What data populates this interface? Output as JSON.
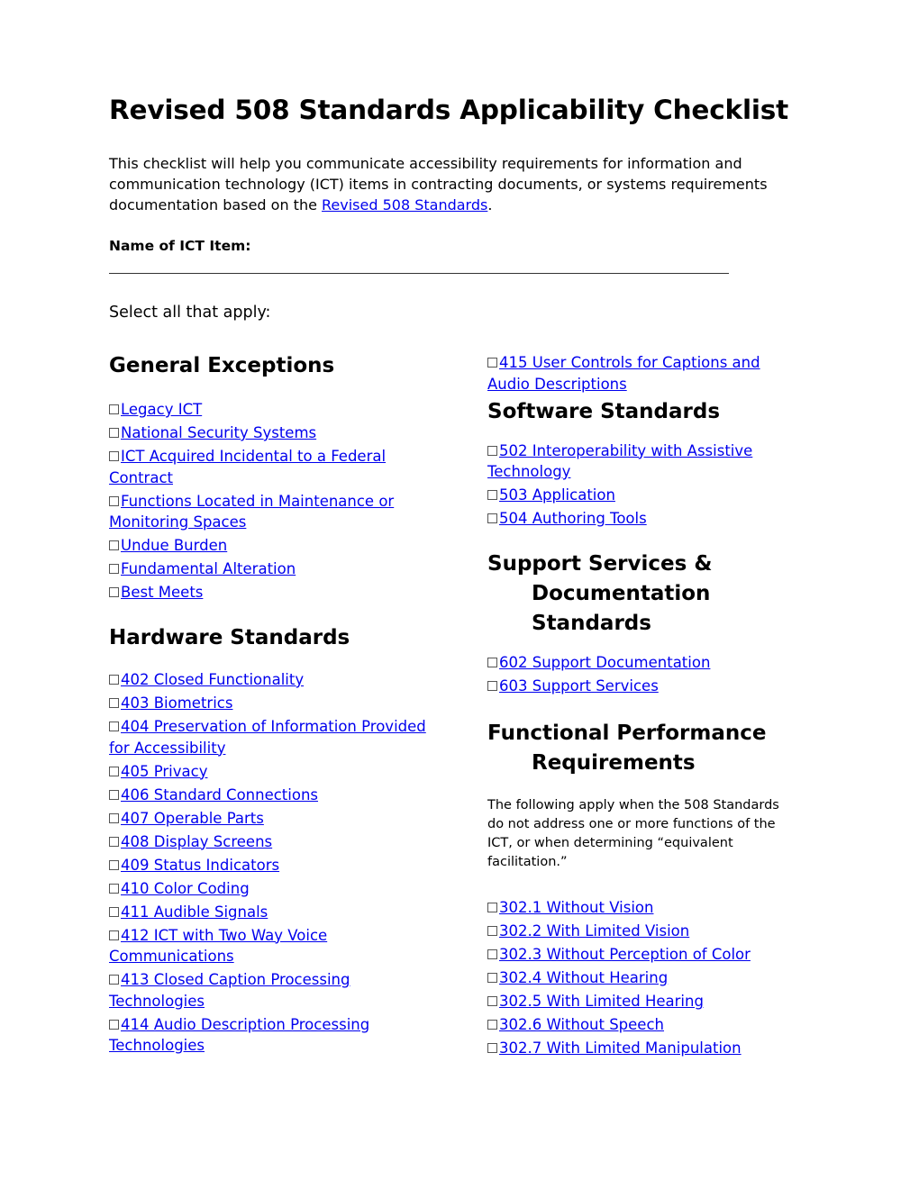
{
  "document": {
    "title": "Revised 508 Standards Applicability Checklist",
    "intro_before_link": "This checklist will help you communicate accessibility requirements for information and communication technology (ICT) items in contracting documents, or systems requirements documentation based on the ",
    "intro_link": "Revised 508 Standards",
    "intro_after_link": ".",
    "name_label": "Name of ICT Item:",
    "name_value": "",
    "select_all": "Select all that apply:"
  },
  "colors": {
    "link": "#0000ee",
    "text": "#000000"
  },
  "checkbox_icon": "empty-checkbox-icon",
  "sections": {
    "general": {
      "heading": "General Exceptions",
      "items": [
        {
          "label": "Legacy ICT",
          "checked": false
        },
        {
          "label": "National Security Systems",
          "checked": false
        },
        {
          "label": "ICT Acquired Incidental to a Federal Contract",
          "checked": false
        },
        {
          "label": "Functions Located in Maintenance or Monitoring Spaces",
          "checked": false
        },
        {
          "label": "Undue Burden",
          "checked": false
        },
        {
          "label": "Fundamental Alteration",
          "checked": false
        },
        {
          "label": "Best Meets",
          "checked": false
        }
      ]
    },
    "hardware": {
      "heading": "Hardware Standards",
      "items": [
        {
          "label": "402 Closed Functionality",
          "checked": false
        },
        {
          "label": "403 Biometrics",
          "checked": false
        },
        {
          "label": "404 Preservation of Information Provided for Accessibility",
          "checked": false
        },
        {
          "label": "405 Privacy",
          "checked": false
        },
        {
          "label": "406 Standard Connections",
          "checked": false
        },
        {
          "label": "407 Operable Parts",
          "checked": false
        },
        {
          "label": "408 Display Screens",
          "checked": false
        },
        {
          "label": "409 Status Indicators",
          "checked": false
        },
        {
          "label": "410 Color Coding",
          "checked": false
        },
        {
          "label": "411 Audible Signals",
          "checked": false
        },
        {
          "label": "412 ICT with Two Way Voice Communications",
          "checked": false
        },
        {
          "label": "413 Closed Caption Processing Technologies",
          "checked": false
        },
        {
          "label": "414 Audio Description Processing Technologies",
          "checked": false
        },
        {
          "label": "415 User Controls for Captions and Audio Descriptions",
          "checked": false
        }
      ]
    },
    "software": {
      "heading": "Software Standards",
      "items": [
        {
          "label": "502 Interoperability with Assistive Technology",
          "checked": false
        },
        {
          "label": "503 Application",
          "checked": false
        },
        {
          "label": "504 Authoring Tools",
          "checked": false
        }
      ]
    },
    "support": {
      "heading": "Support Services & Documentation Standards",
      "items": [
        {
          "label": "602 Support Documentation",
          "checked": false
        },
        {
          "label": "603 Support Services",
          "checked": false
        }
      ]
    },
    "functional": {
      "heading": "Functional Performance Requirements",
      "note": "The following apply when the 508 Standards do not address one or more functions of the ICT, or when determining “equivalent facilitation.”",
      "items": [
        {
          "label": "302.1 Without Vision",
          "checked": false
        },
        {
          "label": "302.2 With Limited Vision",
          "checked": false
        },
        {
          "label": "302.3 Without Perception of Color",
          "checked": false
        },
        {
          "label": "302.4 Without Hearing",
          "checked": false
        },
        {
          "label": "302.5 With Limited Hearing",
          "checked": false
        },
        {
          "label": "302.6 Without Speech",
          "checked": false
        },
        {
          "label": "302.7 With Limited Manipulation",
          "checked": false
        }
      ]
    }
  }
}
